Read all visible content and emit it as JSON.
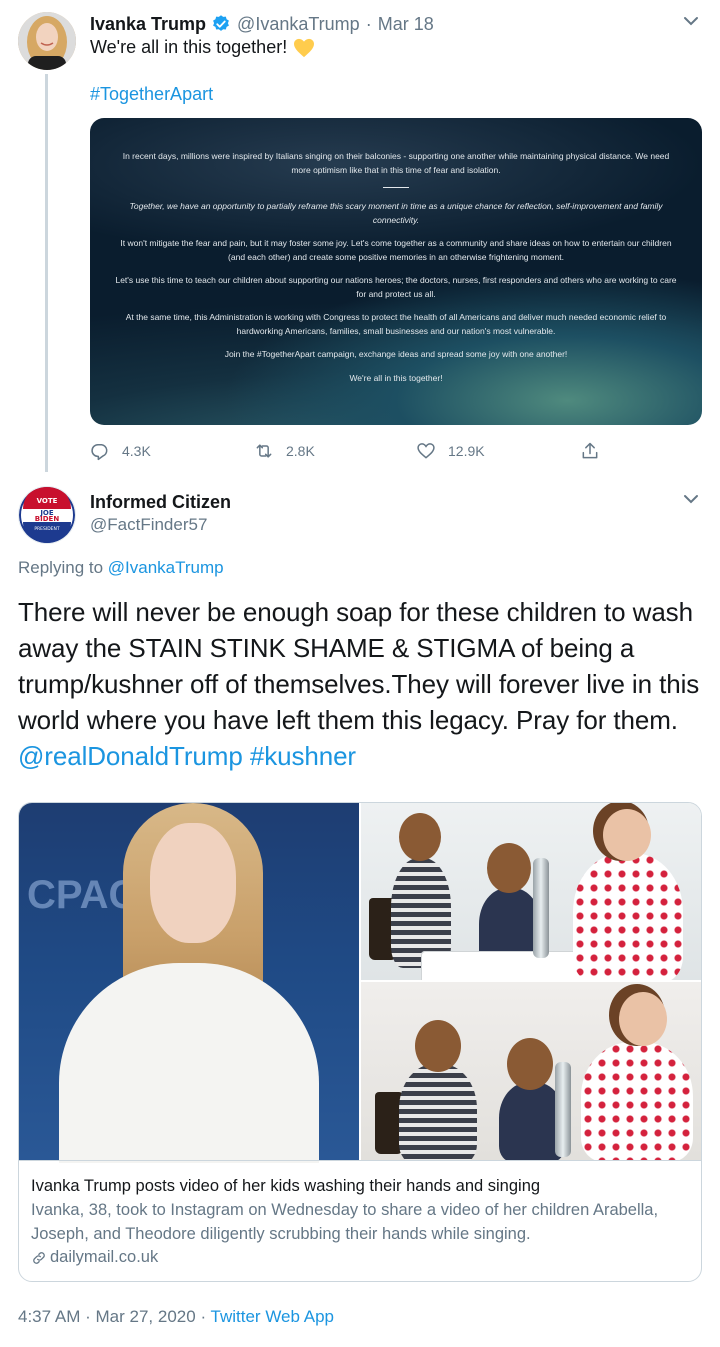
{
  "tweet1": {
    "name": "Ivanka Trump",
    "handle": "@IvankaTrump",
    "separator": "·",
    "date": "Mar 18",
    "text": "We're all in this together!",
    "hashtag": "#TogetherApart",
    "statement": {
      "p1": "In recent days, millions were inspired by Italians singing on their balconies - supporting one another while maintaining physical distance. We need more optimism like that in this time of fear and isolation.",
      "p2": "Together, we have an opportunity to partially reframe this scary moment in time as a unique chance for reflection, self-improvement and family connectivity.",
      "p3": "It won't mitigate the fear and pain, but it may foster some joy. Let's come together as a community and share ideas on how to entertain our children (and each other) and create some positive memories in an otherwise frightening moment.",
      "p4": "Let's use this time to teach our children about supporting our nations heroes; the doctors, nurses, first responders and others who are working to care for and protect us all.",
      "p5": "At the same time, this Administration is working with Congress to protect the health of all Americans and deliver much needed economic relief to hardworking Americans, families, small businesses and our nation's most vulnerable.",
      "p6": "Join the #TogetherApart campaign, exchange ideas and spread some joy with one another!",
      "p7": "We're all in this together!"
    },
    "actions": {
      "replies": "4.3K",
      "retweets": "2.8K",
      "likes": "12.9K"
    }
  },
  "tweet2": {
    "name": "Informed Citizen",
    "handle": "@FactFinder57",
    "avatar_text": {
      "top": "VOTE",
      "middle1": "JOE",
      "middle2": "BIDEN",
      "bottom": "PRESIDENT"
    },
    "replying_prefix": "Replying to",
    "replying_to": "@IvankaTrump",
    "text": "There will never be enough soap for these children to wash away the STAIN STINK SHAME & STIGMA of being a trump/kushner off of themselves.They will forever live in this world where you have left them this legacy. Pray for them.",
    "mention": "@realDonaldTrump",
    "hashtag": "#kushner",
    "card": {
      "title": "Ivanka Trump posts video of her kids washing their hands and singing",
      "description": "Ivanka, 38, took to Instagram on Wednesday to share a video of her children Arabella, Joseph, and Theodore diligently scrubbing their hands while singing.",
      "domain": "dailymail.co.uk",
      "stage_text": "CPAC"
    },
    "footer": {
      "time": "4:37 AM",
      "separator": "·",
      "date": "Mar 27, 2020",
      "separator2": "·",
      "source": "Twitter Web App"
    }
  },
  "colors": {
    "link": "#1b95e0",
    "secondary": "#657786",
    "verified": "#1da1f2",
    "heart_emoji": "#ffcc4d"
  },
  "icons": [
    "verified-badge-icon",
    "chevron-down-icon",
    "yellow-heart-icon",
    "reply-icon",
    "retweet-icon",
    "like-icon",
    "share-icon",
    "link-icon"
  ]
}
